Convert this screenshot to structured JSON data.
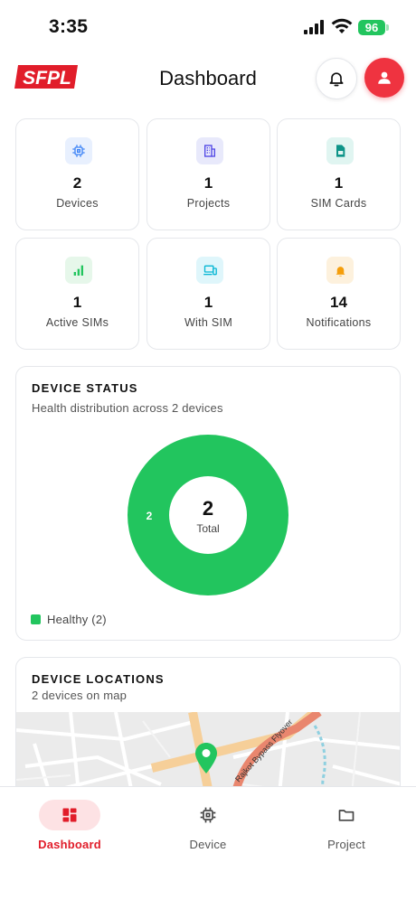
{
  "status_bar": {
    "time": "3:35",
    "battery": "96"
  },
  "header": {
    "logo_text": "SFPL",
    "title": "Dashboard"
  },
  "stats": [
    {
      "value": "2",
      "label": "Devices",
      "icon": "chip-icon",
      "color": "#3b82f6"
    },
    {
      "value": "1",
      "label": "Projects",
      "icon": "building-icon",
      "color": "#4f46e5"
    },
    {
      "value": "1",
      "label": "SIM Cards",
      "icon": "sim-card-icon",
      "color": "#0d9488"
    },
    {
      "value": "1",
      "label": "Active SIMs",
      "icon": "signal-bars-icon",
      "color": "#22c55e"
    },
    {
      "value": "1",
      "label": "With SIM",
      "icon": "devices-icon",
      "color": "#06b6d4"
    },
    {
      "value": "14",
      "label": "Notifications",
      "icon": "bell-icon",
      "color": "#f59e0b"
    }
  ],
  "device_status": {
    "title": "DEVICE STATUS",
    "subtitle": "Health distribution across 2 devices",
    "center_value": "2",
    "center_label": "Total",
    "legend_label": "Healthy (2)",
    "chart_data": {
      "type": "pie",
      "slices": [
        {
          "label": "Healthy",
          "value": 2,
          "color": "#22c55e"
        }
      ]
    },
    "slice_label": "2"
  },
  "device_locations": {
    "title": "DEVICE LOCATIONS",
    "subtitle": "2 devices on map",
    "road_label": "Rajkot Bypass Flyover"
  },
  "bottom_nav": {
    "items": [
      {
        "label": "Dashboard",
        "icon": "dashboard-icon",
        "active": true
      },
      {
        "label": "Device",
        "icon": "chip-icon",
        "active": false
      },
      {
        "label": "Project",
        "icon": "folder-icon",
        "active": false
      }
    ]
  },
  "colors": {
    "brand": "#ef3340",
    "healthy": "#22c55e"
  }
}
